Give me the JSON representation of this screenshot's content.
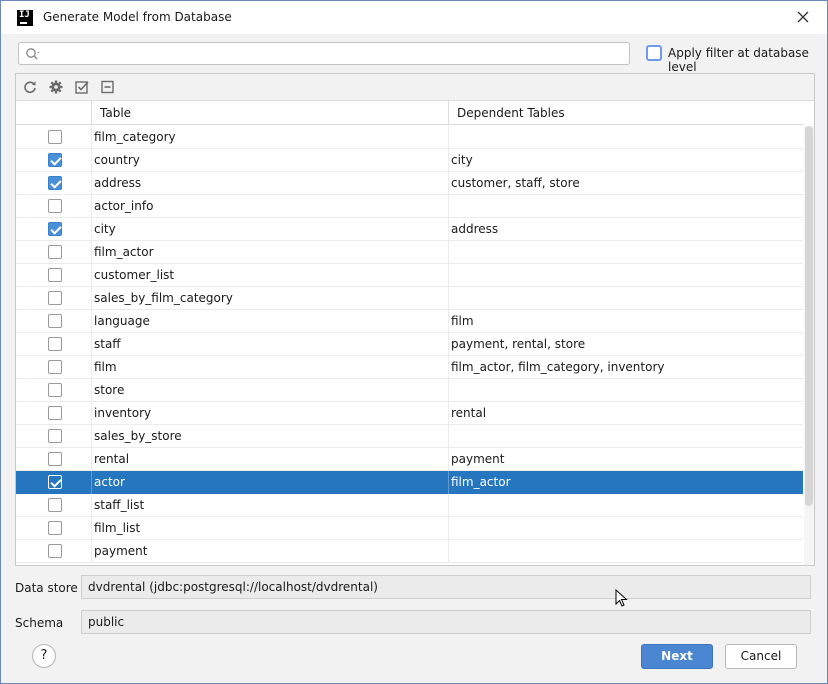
{
  "window": {
    "title": "Generate Model from Database"
  },
  "search": {
    "value": "",
    "placeholder": ""
  },
  "filter": {
    "label": "Apply filter at database level",
    "checked": false
  },
  "toolbar": {
    "icons": [
      "refresh-icon",
      "gear-icon",
      "check-all-icon",
      "collapse-icon"
    ]
  },
  "table": {
    "headers": {
      "table": "Table",
      "dependent": "Dependent Tables"
    },
    "rows": [
      {
        "checked": false,
        "name": "film_category",
        "dependent": ""
      },
      {
        "checked": true,
        "name": "country",
        "dependent": "city"
      },
      {
        "checked": true,
        "name": "address",
        "dependent": "customer, staff, store"
      },
      {
        "checked": false,
        "name": "actor_info",
        "dependent": ""
      },
      {
        "checked": true,
        "name": "city",
        "dependent": "address"
      },
      {
        "checked": false,
        "name": "film_actor",
        "dependent": ""
      },
      {
        "checked": false,
        "name": "customer_list",
        "dependent": ""
      },
      {
        "checked": false,
        "name": "sales_by_film_category",
        "dependent": ""
      },
      {
        "checked": false,
        "name": "language",
        "dependent": "film"
      },
      {
        "checked": false,
        "name": "staff",
        "dependent": "payment, rental, store"
      },
      {
        "checked": false,
        "name": "film",
        "dependent": "film_actor, film_category, inventory"
      },
      {
        "checked": false,
        "name": "store",
        "dependent": ""
      },
      {
        "checked": false,
        "name": "inventory",
        "dependent": "rental"
      },
      {
        "checked": false,
        "name": "sales_by_store",
        "dependent": ""
      },
      {
        "checked": false,
        "name": "rental",
        "dependent": "payment"
      },
      {
        "checked": true,
        "name": "actor",
        "dependent": "film_actor",
        "selected": true
      },
      {
        "checked": false,
        "name": "staff_list",
        "dependent": ""
      },
      {
        "checked": false,
        "name": "film_list",
        "dependent": ""
      },
      {
        "checked": false,
        "name": "payment",
        "dependent": ""
      }
    ]
  },
  "datastore": {
    "label": "Data store",
    "value": "dvdrental (jdbc:postgresql://localhost/dvdrental)"
  },
  "schema": {
    "label": "Schema",
    "value": "public"
  },
  "buttons": {
    "help": "?",
    "next": "Next",
    "cancel": "Cancel"
  },
  "colors": {
    "selection": "#2675bf",
    "primary_button": "#4a86d1",
    "checkbox_checked": "#4a90d9"
  }
}
